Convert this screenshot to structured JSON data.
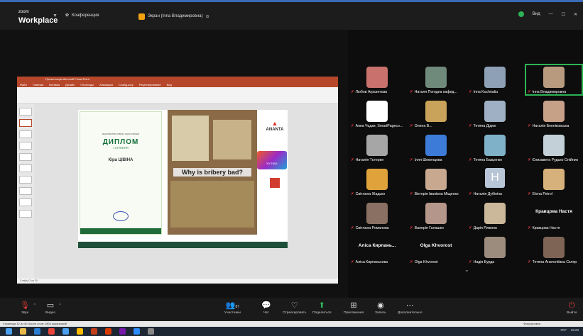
{
  "app": {
    "logo_small": "zoom",
    "logo_big": "Workplace",
    "meeting_label": "Конференция",
    "share_banner": "Экран (Inna Владимировна)",
    "view_label": "Вид",
    "colors": {
      "accent": "#2db355",
      "mute": "#e23a3a",
      "share": "#f2a10f",
      "ppt": "#b7472a"
    }
  },
  "slide": {
    "window_title": "Презентація Microsoft PowerPoint",
    "tabs": [
      "Файл",
      "Главная",
      "Вставка",
      "Дизайн",
      "Переходы",
      "Анимация",
      "Слайд-шоу",
      "Рецензирование",
      "Вид"
    ],
    "diploma_ministry": "МІНІСТЕРСТВО ОСВІТИ І НАУКИ УКРАЇНИ",
    "diploma_title": "ДИПЛОМ",
    "diploma_degree": "І СТУПЕНЯ",
    "diploma_name": "Кіра ЦІВІНА",
    "poster_question": "Why is bribery bad?",
    "logo_text": "ANANTA",
    "card_text": "ЮСТИКА",
    "status_left": "Слайд 12 из 30"
  },
  "participants": [
    {
      "name": "Любов Агрєвнтєва",
      "face": "#c9716d"
    },
    {
      "name": "Наталя Погодна кафед...",
      "face": "#6f8a7a"
    },
    {
      "name": "Inna Kuchnatiu",
      "face": "#8da0b5"
    },
    {
      "name": "Інна Владимировна",
      "face": "#b89a7f",
      "speaking": true
    },
    {
      "name": "Анна Чєдзи, SmartPageco...",
      "face": "#ffffff"
    },
    {
      "name": "Олена В...",
      "face": "#c9a35a"
    },
    {
      "name": "Тетяна Дідюк",
      "face": "#9fb0c4"
    },
    {
      "name": "Наталія Бенніковська",
      "face": "#c7a088"
    },
    {
      "name": "Наталія Тєтерин",
      "face": "#a6a6a6"
    },
    {
      "name": "Ілля Шекенцова",
      "face": "#3d7bd9"
    },
    {
      "name": "Тетяна Базценко",
      "face": "#7fb1c9"
    },
    {
      "name": "Єлизавета Рудько Олійник",
      "face": "#c3d0d8"
    },
    {
      "name": "Світлана Жадько",
      "face": "#e0a23a"
    },
    {
      "name": "Вікторія Іванівна Міщенко",
      "face": "#c8a990"
    },
    {
      "name": "Наталія Дубініна",
      "face": "H"
    },
    {
      "name": "Elena Petrol",
      "face": "#d6b17c"
    },
    {
      "name": "Світлана Романова",
      "face": "#8a7062"
    },
    {
      "name": "Валерія Галашко",
      "face": "#b5968b"
    },
    {
      "name": "Дарія Рижина",
      "face": "#cbb79a"
    },
    {
      "name": "Кравцова Настя",
      "face": "text"
    },
    {
      "name": "Аліса Кирпанькова",
      "face": "text",
      "big": "Аліса Кирпань..."
    },
    {
      "name": "Olga Khvorost",
      "face": "text",
      "big": "Olga Khvorost"
    },
    {
      "name": "Надія Бурда",
      "face": "#9c8c7d"
    },
    {
      "name": "Тетяна Анатоліївна Скляр",
      "face": "#7e6455"
    }
  ],
  "toolbar": {
    "audio": "Звук",
    "video": "Видео",
    "participants_count": "87",
    "participants": "Участники",
    "chat": "Чат",
    "react": "Отреагировать",
    "share": "Поделиться",
    "apps": "Приложения",
    "record": "Запись",
    "more": "Дополнительно",
    "leave": "Выйти"
  },
  "statusbar": {
    "left": "Страница 12 из 40    Число слов: 2804    украинский",
    "right": "Фокусировка"
  },
  "taskbar": {
    "time": "16:23",
    "lang": "УКР"
  }
}
